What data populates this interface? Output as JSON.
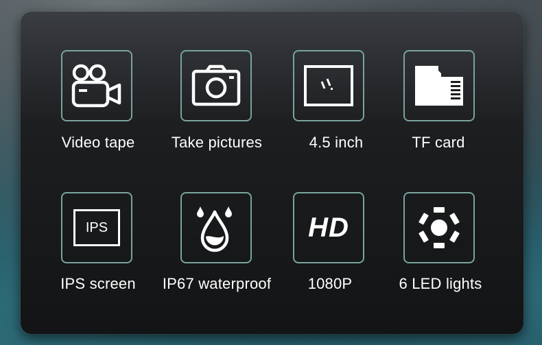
{
  "features": [
    {
      "icon": "video-camera-icon",
      "label": "Video tape"
    },
    {
      "icon": "photo-camera-icon",
      "label": "Take pictures"
    },
    {
      "icon": "screen-size-icon",
      "label": "4.5 inch"
    },
    {
      "icon": "tf-card-icon",
      "label": "TF card"
    },
    {
      "icon": "ips-screen-icon",
      "label": "IPS screen",
      "icon_text": "IPS"
    },
    {
      "icon": "waterdrop-icon",
      "label": "IP67 waterproof"
    },
    {
      "icon": "hd-icon",
      "label": "1080P",
      "icon_text": "HD"
    },
    {
      "icon": "led-lights-icon",
      "label": "6 LED lights"
    }
  ],
  "colors": {
    "tile_border": "#7aa3a0",
    "icon": "#ffffff",
    "text": "#ffffff"
  }
}
